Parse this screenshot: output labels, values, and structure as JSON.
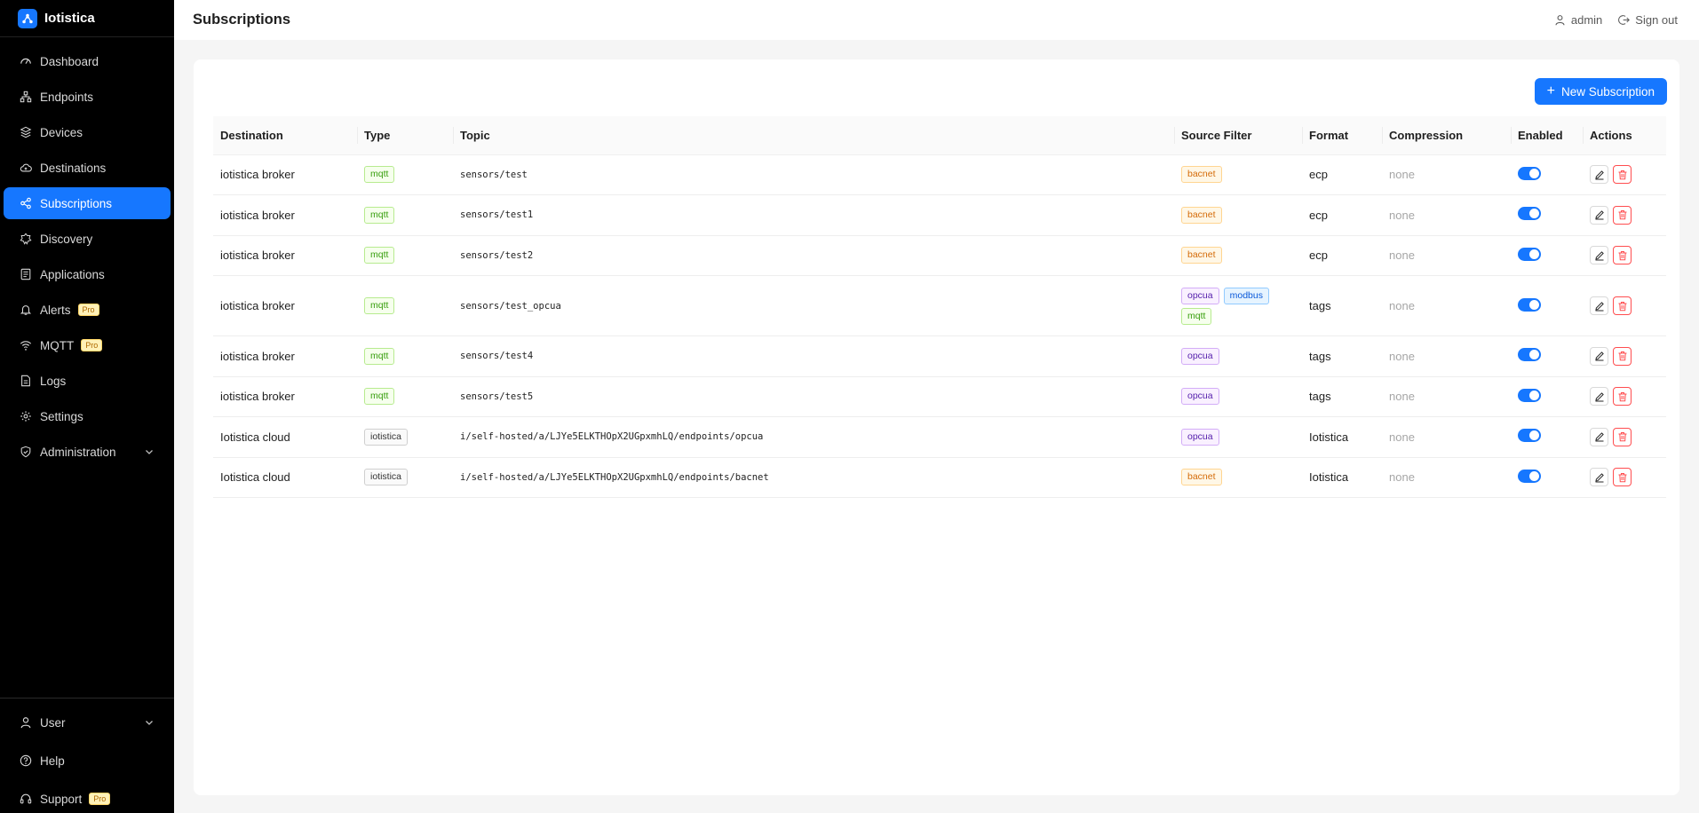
{
  "app": {
    "name": "Iotistica"
  },
  "sidebar": {
    "items": [
      {
        "label": "Dashboard",
        "icon": "dashboard-icon"
      },
      {
        "label": "Endpoints",
        "icon": "endpoints-icon"
      },
      {
        "label": "Devices",
        "icon": "devices-icon"
      },
      {
        "label": "Destinations",
        "icon": "cloud-icon"
      },
      {
        "label": "Subscriptions",
        "icon": "share-icon",
        "active": true
      },
      {
        "label": "Discovery",
        "icon": "discovery-icon"
      },
      {
        "label": "Applications",
        "icon": "applications-icon"
      },
      {
        "label": "Alerts",
        "icon": "bell-icon",
        "badge": "Pro"
      },
      {
        "label": "MQTT",
        "icon": "wifi-icon",
        "badge": "Pro"
      },
      {
        "label": "Logs",
        "icon": "file-icon"
      },
      {
        "label": "Settings",
        "icon": "gear-icon"
      },
      {
        "label": "Administration",
        "icon": "shield-icon"
      }
    ],
    "bottom": [
      {
        "label": "User",
        "icon": "user-icon"
      },
      {
        "label": "Help",
        "icon": "help-icon"
      },
      {
        "label": "Support",
        "icon": "headset-icon",
        "badge": "Pro"
      }
    ]
  },
  "header": {
    "title": "Subscriptions",
    "user": "admin",
    "signout": "Sign out"
  },
  "toolbar": {
    "new_label": "New Subscription"
  },
  "table": {
    "columns": [
      "Destination",
      "Type",
      "Topic",
      "Source Filter",
      "Format",
      "Compression",
      "Enabled",
      "Actions"
    ],
    "rows": [
      {
        "destination": "iotistica broker",
        "type": "mqtt",
        "topic": "sensors/test",
        "filters": [
          "bacnet"
        ],
        "format": "ecp",
        "compression": "none",
        "enabled": true
      },
      {
        "destination": "iotistica broker",
        "type": "mqtt",
        "topic": "sensors/test1",
        "filters": [
          "bacnet"
        ],
        "format": "ecp",
        "compression": "none",
        "enabled": true
      },
      {
        "destination": "iotistica broker",
        "type": "mqtt",
        "topic": "sensors/test2",
        "filters": [
          "bacnet"
        ],
        "format": "ecp",
        "compression": "none",
        "enabled": true
      },
      {
        "destination": "iotistica broker",
        "type": "mqtt",
        "topic": "sensors/test_opcua",
        "filters": [
          "opcua",
          "modbus",
          "mqtt"
        ],
        "format": "tags",
        "compression": "none",
        "enabled": true
      },
      {
        "destination": "iotistica broker",
        "type": "mqtt",
        "topic": "sensors/test4",
        "filters": [
          "opcua"
        ],
        "format": "tags",
        "compression": "none",
        "enabled": true
      },
      {
        "destination": "iotistica broker",
        "type": "mqtt",
        "topic": "sensors/test5",
        "filters": [
          "opcua"
        ],
        "format": "tags",
        "compression": "none",
        "enabled": true
      },
      {
        "destination": "Iotistica cloud",
        "type": "iotistica",
        "topic": "i/self-hosted/a/LJYe5ELKTHOpX2UGpxmhLQ/endpoints/opcua",
        "filters": [
          "opcua"
        ],
        "format": "Iotistica",
        "compression": "none",
        "enabled": true
      },
      {
        "destination": "Iotistica cloud",
        "type": "iotistica",
        "topic": "i/self-hosted/a/LJYe5ELKTHOpX2UGpxmhLQ/endpoints/bacnet",
        "filters": [
          "bacnet"
        ],
        "format": "Iotistica",
        "compression": "none",
        "enabled": true
      }
    ]
  },
  "colors": {
    "accent": "#1677ff",
    "sidebar_bg": "#000000",
    "danger": "#ff4d4f"
  }
}
